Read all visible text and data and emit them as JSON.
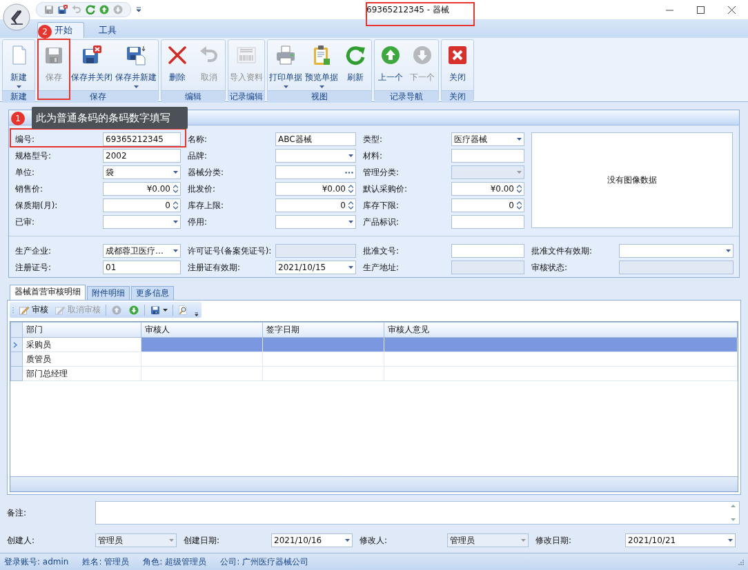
{
  "window": {
    "title": "69365212345 - 器械"
  },
  "quick_access": [
    {
      "kind": "save",
      "disabled": true
    },
    {
      "kind": "save_close",
      "disabled": false
    },
    {
      "kind": "undo",
      "disabled": true
    },
    {
      "kind": "refresh",
      "disabled": false
    },
    {
      "kind": "up",
      "disabled": false
    },
    {
      "kind": "down",
      "disabled": true
    }
  ],
  "ribbon_tabs": [
    {
      "label": "开始",
      "selected": true
    },
    {
      "label": "工具",
      "selected": false
    }
  ],
  "ribbon_groups": [
    {
      "label": "新建",
      "buttons": [
        {
          "kind": "new",
          "label": "新建",
          "disabled": false,
          "dropdown": true
        }
      ]
    },
    {
      "label": "保存",
      "buttons": [
        {
          "kind": "save",
          "label": "保存",
          "disabled": true,
          "dropdown": false
        },
        {
          "kind": "save_close",
          "label": "保存并关闭",
          "disabled": false,
          "dropdown": false
        },
        {
          "kind": "save_new",
          "label": "保存并新建",
          "disabled": false,
          "dropdown": true
        }
      ]
    },
    {
      "label": "编辑",
      "buttons": [
        {
          "kind": "delete",
          "label": "删除",
          "disabled": false,
          "dropdown": false
        },
        {
          "kind": "undo",
          "label": "取消",
          "disabled": true,
          "dropdown": false
        }
      ]
    },
    {
      "label": "记录编辑",
      "buttons": [
        {
          "kind": "udi",
          "label": "导入资料",
          "disabled": true,
          "dropdown": false
        }
      ]
    },
    {
      "label": "视图",
      "buttons": [
        {
          "kind": "print",
          "label": "打印单据",
          "disabled": false,
          "dropdown": true
        },
        {
          "kind": "preview",
          "label": "预览单据",
          "disabled": false,
          "dropdown": true
        },
        {
          "kind": "refresh",
          "label": "刷新",
          "disabled": false,
          "dropdown": false
        }
      ]
    },
    {
      "label": "记录导航",
      "buttons": [
        {
          "kind": "up",
          "label": "上一个",
          "disabled": false,
          "dropdown": false
        },
        {
          "kind": "down",
          "label": "下一个",
          "disabled": true,
          "dropdown": false
        }
      ]
    },
    {
      "label": "关闭",
      "buttons": [
        {
          "kind": "close",
          "label": "关闭",
          "disabled": false,
          "dropdown": false
        }
      ]
    }
  ],
  "callouts": [
    {
      "number": "1",
      "text": "此为普通条码的条码数字填写"
    },
    {
      "number": "2"
    }
  ],
  "form": {
    "upper": [
      {
        "label": "编号:",
        "kind": "text",
        "value": "69365212345",
        "disabled": false
      },
      {
        "label": "名称:",
        "kind": "text",
        "value": "ABC器械",
        "disabled": false
      },
      {
        "label": "类型:",
        "kind": "combo",
        "value": "医疗器械",
        "disabled": false
      },
      {
        "label": "规格型号:",
        "kind": "text",
        "value": "2002",
        "disabled": false
      },
      {
        "label": "品牌:",
        "kind": "combo",
        "disabled": false
      },
      {
        "label": "材料:",
        "kind": "text",
        "disabled": false
      },
      {
        "label": "单位:",
        "kind": "combo",
        "value": "袋",
        "disabled": false
      },
      {
        "label": "器械分类:",
        "kind": "ellipsis",
        "disabled": false
      },
      {
        "label": "管理分类:",
        "kind": "combo",
        "disabled": true
      },
      {
        "label": "销售价:",
        "kind": "spin",
        "value": "¥0.00",
        "disabled": false
      },
      {
        "label": "批发价:",
        "kind": "spin",
        "value": "¥0.00",
        "disabled": false
      },
      {
        "label": "默认采购价:",
        "kind": "spin",
        "value": "¥0.00",
        "disabled": false
      },
      {
        "label": "保质期(月):",
        "kind": "spin",
        "value": "0",
        "disabled": false
      },
      {
        "label": "库存上限:",
        "kind": "spin",
        "value": "0",
        "disabled": false
      },
      {
        "label": "库存下限:",
        "kind": "spin",
        "value": "0",
        "disabled": false
      },
      {
        "label": "已审:",
        "kind": "combo",
        "disabled": false
      },
      {
        "label": "停用:",
        "kind": "combo",
        "disabled": false
      },
      {
        "label": "产品标识:",
        "kind": "text",
        "disabled": false
      }
    ],
    "image_placeholder": "没有图像数据",
    "lower": [
      {
        "label": "生产企业:",
        "kind": "combo",
        "value": "成都蓉卫医疗…",
        "disabled": false
      },
      {
        "label": "许可证号(备案凭证号):",
        "kind": "text",
        "disabled": true
      },
      {
        "label": "批准文号:",
        "kind": "text",
        "disabled": false
      },
      {
        "label": "批准文件有效期:",
        "kind": "combo",
        "disabled": false
      },
      {
        "label": "注册证号:",
        "kind": "text",
        "value": "01",
        "disabled": false
      },
      {
        "label": "注册证有效期:",
        "kind": "combo",
        "value": "2021/10/15",
        "disabled": false
      },
      {
        "label": "生产地址:",
        "kind": "text",
        "disabled": true
      },
      {
        "label": "审核状态:",
        "kind": "text",
        "disabled": true
      }
    ]
  },
  "detail_tabs": [
    {
      "label": "器械首营审核明细",
      "selected": true
    },
    {
      "label": "附件明细",
      "selected": false
    },
    {
      "label": "更多信息",
      "selected": false
    }
  ],
  "detail_toolbar": [
    {
      "kind": "approve",
      "label": "审核",
      "disabled": false
    },
    {
      "kind": "unapprove",
      "label": "取消审核",
      "disabled": true
    },
    {
      "kind": "up",
      "disabled": true
    },
    {
      "kind": "down",
      "disabled": false
    },
    {
      "kind": "save",
      "disabled": false
    },
    {
      "kind": "find",
      "disabled": false
    }
  ],
  "grid": {
    "columns": [
      "部门",
      "审核人",
      "签字日期",
      "审核人意见"
    ],
    "rows": [
      {
        "cells": [
          "采购员"
        ],
        "selected": true
      },
      {
        "cells": [
          "质管员"
        ],
        "selected": false
      },
      {
        "cells": [
          "部门总经理"
        ],
        "selected": false
      }
    ]
  },
  "memo": {
    "label": "备注:"
  },
  "footer_fields": [
    {
      "label": "创建人:",
      "kind": "combo",
      "value": "管理员",
      "disabled": true
    },
    {
      "label": "创建日期:",
      "kind": "combo",
      "value": "2021/10/16",
      "disabled": false
    },
    {
      "label": "修改人:",
      "kind": "combo",
      "value": "管理员",
      "disabled": true
    },
    {
      "label": "修改日期:",
      "kind": "combo",
      "value": "2021/10/21",
      "disabled": false
    }
  ],
  "status_bar": [
    "登录账号: admin",
    "姓名: 管理员",
    "角色: 超级管理员",
    "公司: 广州医疗器械公司"
  ]
}
